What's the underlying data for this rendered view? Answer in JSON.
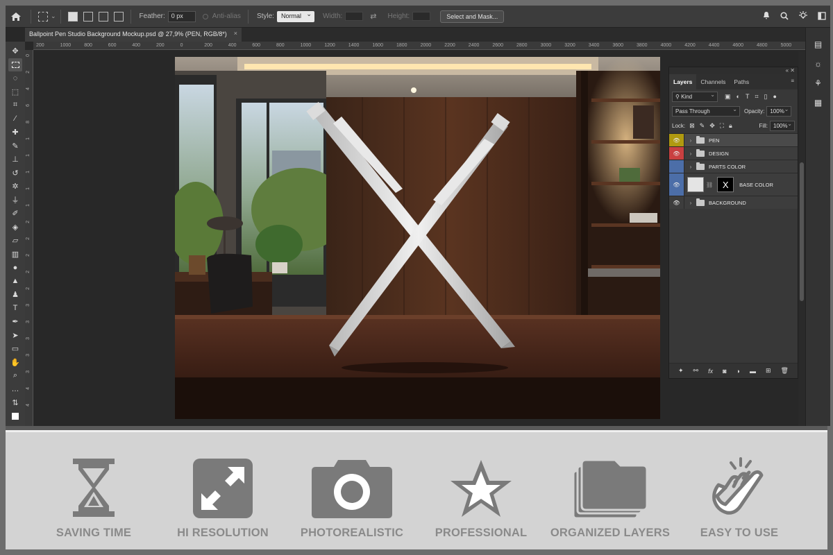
{
  "options_bar": {
    "feather_label": "Feather:",
    "feather_value": "0 px",
    "anti_alias_label": "Anti-alias",
    "style_label": "Style:",
    "style_value": "Normal",
    "width_label": "Width:",
    "height_label": "Height:",
    "select_mask_button": "Select and Mask..."
  },
  "document_tab": {
    "title": "Ballpoint Pen Studio Background Mockup.psd @ 27,9% (PEN, RGB/8*)",
    "close": "×"
  },
  "rulers": {
    "horizontal": [
      "200",
      "1000",
      "800",
      "600",
      "400",
      "200",
      "0",
      "200",
      "400",
      "600",
      "800",
      "1000",
      "1200",
      "1400",
      "1600",
      "1800",
      "2000",
      "2200",
      "2400",
      "2600",
      "2800",
      "3000",
      "3200",
      "3400",
      "3600",
      "3800",
      "4000",
      "4200",
      "4400",
      "4600",
      "4800",
      "5000"
    ],
    "vertical": [
      "0",
      "2",
      "4",
      "6",
      "8",
      "1",
      "1",
      "1",
      "1",
      "1",
      "2",
      "2",
      "2",
      "2",
      "2",
      "3",
      "3",
      "3",
      "3",
      "3",
      "4",
      "4"
    ]
  },
  "layers_panel": {
    "tabs": [
      "Layers",
      "Channels",
      "Paths"
    ],
    "active_tab": "Layers",
    "filter_kind": "Kind",
    "blend_mode": "Pass Through",
    "opacity_label": "Opacity:",
    "opacity_value": "100%",
    "lock_label": "Lock:",
    "fill_label": "Fill:",
    "fill_value": "100%",
    "layers": [
      {
        "name": "PEN",
        "color": "#b09a10",
        "visible": true
      },
      {
        "name": "DESIGN",
        "color": "#c94040",
        "visible": true
      },
      {
        "name": "PARTS COLOR",
        "color": "#4c6ea8",
        "visible": false
      },
      {
        "name": "BASE COLOR",
        "color": "#4c6ea8",
        "visible": true
      },
      {
        "name": "BACKGROUND",
        "color": "#3d3d3d",
        "visible": true
      }
    ],
    "base_color_mask_glyph": "X"
  },
  "features": [
    {
      "label": "SAVING TIME",
      "icon": "hourglass-icon"
    },
    {
      "label": "HI RESOLUTION",
      "icon": "expand-arrows-icon"
    },
    {
      "label": "PHOTOREALISTIC",
      "icon": "camera-icon"
    },
    {
      "label": "PROFESSIONAL",
      "icon": "star-icon"
    },
    {
      "label": "ORGANIZED LAYERS",
      "icon": "layers-stack-icon"
    },
    {
      "label": "EASY TO USE",
      "icon": "hand-tap-icon"
    }
  ],
  "colors": {
    "feature_icon": "#7a7a7a",
    "feature_strip_bg": "#d3d3d3",
    "app_bg": "#282828"
  }
}
